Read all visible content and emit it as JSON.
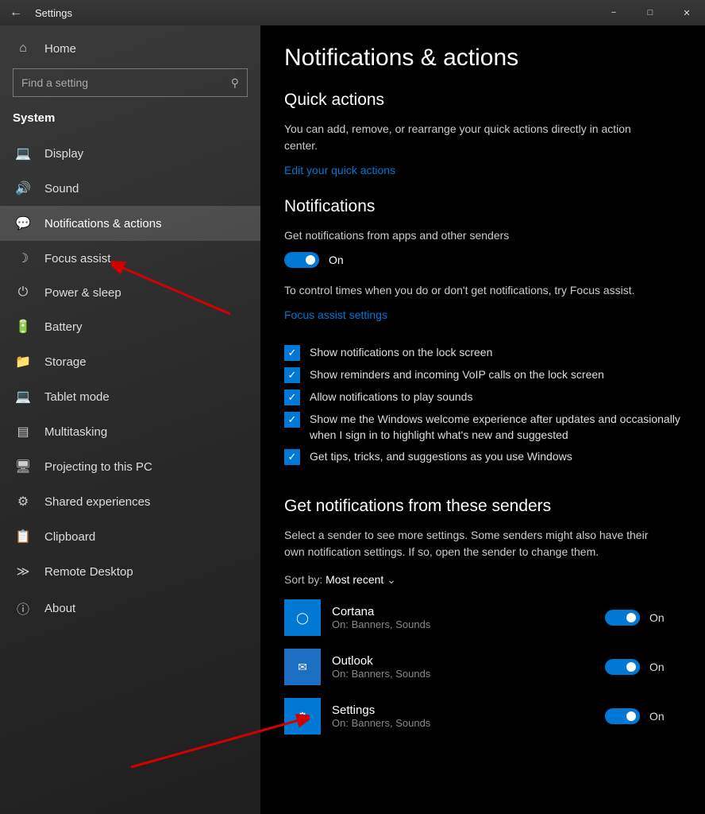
{
  "titlebar": {
    "title": "Settings"
  },
  "sidebar": {
    "home": "Home",
    "search_placeholder": "Find a setting",
    "section": "System",
    "items": [
      {
        "label": "Display"
      },
      {
        "label": "Sound"
      },
      {
        "label": "Notifications & actions"
      },
      {
        "label": "Focus assist"
      },
      {
        "label": "Power & sleep"
      },
      {
        "label": "Battery"
      },
      {
        "label": "Storage"
      },
      {
        "label": "Tablet mode"
      },
      {
        "label": "Multitasking"
      },
      {
        "label": "Projecting to this PC"
      },
      {
        "label": "Shared experiences"
      },
      {
        "label": "Clipboard"
      },
      {
        "label": "Remote Desktop"
      },
      {
        "label": "About"
      }
    ]
  },
  "main": {
    "heading": "Notifications & actions",
    "quick_actions": {
      "title": "Quick actions",
      "desc": "You can add, remove, or rearrange your quick actions directly in action center.",
      "link": "Edit your quick actions"
    },
    "notifications": {
      "title": "Notifications",
      "get_label": "Get notifications from apps and other senders",
      "on": "On",
      "focus_hint": "To control times when you do or don't get notifications, try Focus assist.",
      "focus_link": "Focus assist settings",
      "checks": [
        "Show notifications on the lock screen",
        "Show reminders and incoming VoIP calls on the lock screen",
        "Allow notifications to play sounds",
        "Show me the Windows welcome experience after updates and occasionally when I sign in to highlight what's new and suggested",
        "Get tips, tricks, and suggestions as you use Windows"
      ]
    },
    "senders": {
      "title": "Get notifications from these senders",
      "desc": "Select a sender to see more settings. Some senders might also have their own notification settings. If so, open the sender to change them.",
      "sort_label": "Sort by:",
      "sort_value": "Most recent",
      "apps": [
        {
          "name": "Cortana",
          "sub": "On: Banners, Sounds",
          "state": "On"
        },
        {
          "name": "Outlook",
          "sub": "On: Banners, Sounds",
          "state": "On"
        },
        {
          "name": "Settings",
          "sub": "On: Banners, Sounds",
          "state": "On"
        }
      ]
    }
  }
}
